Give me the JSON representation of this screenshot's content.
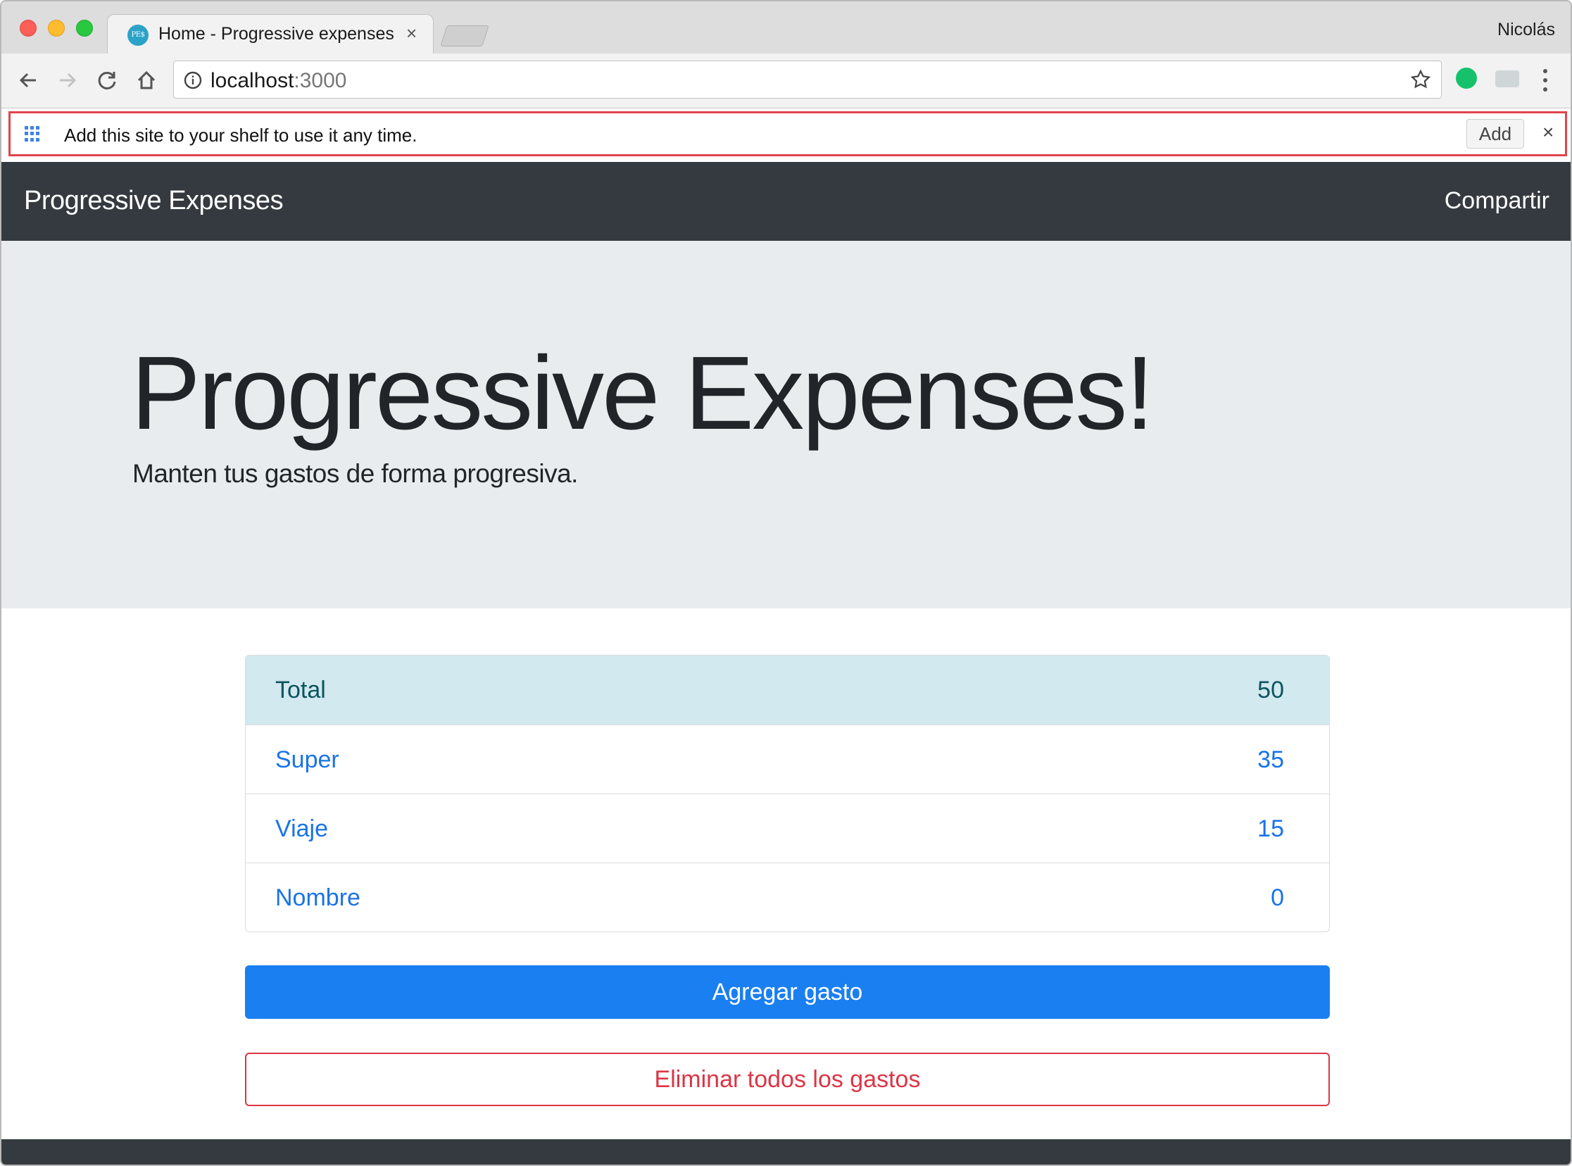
{
  "browser": {
    "tab_title": "Home - Progressive expenses",
    "tab_favicon_text": "PE$",
    "tab_close": "×",
    "profile_name": "Nicolás",
    "url_host": "localhost",
    "url_port": ":3000",
    "icons": [
      "back-icon",
      "forward-icon",
      "reload-icon",
      "home-icon",
      "info-icon",
      "star-icon",
      "grammarly-icon",
      "cast-icon",
      "menu-icon"
    ]
  },
  "infobar": {
    "text": "Add this site to your shelf to use it any time.",
    "add_label": "Add",
    "close_label": "×",
    "border_color": "#e0454c"
  },
  "navbar": {
    "brand": "Progressive Expenses",
    "share": "Compartir"
  },
  "jumbotron": {
    "title": "Progressive Expenses!",
    "lead": "Manten tus gastos de forma progresiva."
  },
  "expenses": {
    "total": {
      "name": "Total",
      "value": "50"
    },
    "items": [
      {
        "name": "Super",
        "value": "35"
      },
      {
        "name": "Viaje",
        "value": "15"
      },
      {
        "name": "Nombre",
        "value": "0"
      }
    ]
  },
  "actions": {
    "add": "Agregar gasto",
    "delete_all": "Eliminar todos los gastos"
  },
  "colors": {
    "navbar": "#343a40",
    "primary": "#1a7ff1",
    "danger": "#dc3545",
    "info_row": "#d1e9ef"
  }
}
